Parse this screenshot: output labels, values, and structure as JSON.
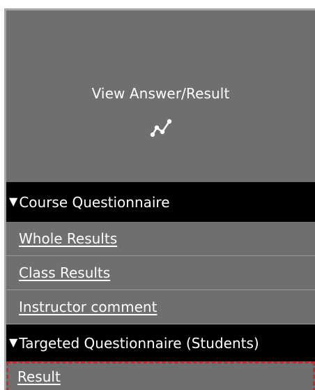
{
  "menu": {
    "view_answer": {
      "label": "View Answer/Result",
      "icon": "line-chart-icon"
    },
    "sections": [
      {
        "toggle_glyph": "▼",
        "title": "Course Questionnaire",
        "items": [
          {
            "label": "Whole Results"
          },
          {
            "label": "Class Results"
          },
          {
            "label": "Instructor comment"
          }
        ]
      },
      {
        "toggle_glyph": "▼",
        "title": "Targeted Questionnaire (Students)",
        "items": [
          {
            "label": "Result"
          }
        ]
      }
    ]
  },
  "colors": {
    "panel_background": "#6f6f6f",
    "section_header_background": "#000000",
    "text": "#ffffff",
    "highlight_outline": "#c4272d"
  }
}
